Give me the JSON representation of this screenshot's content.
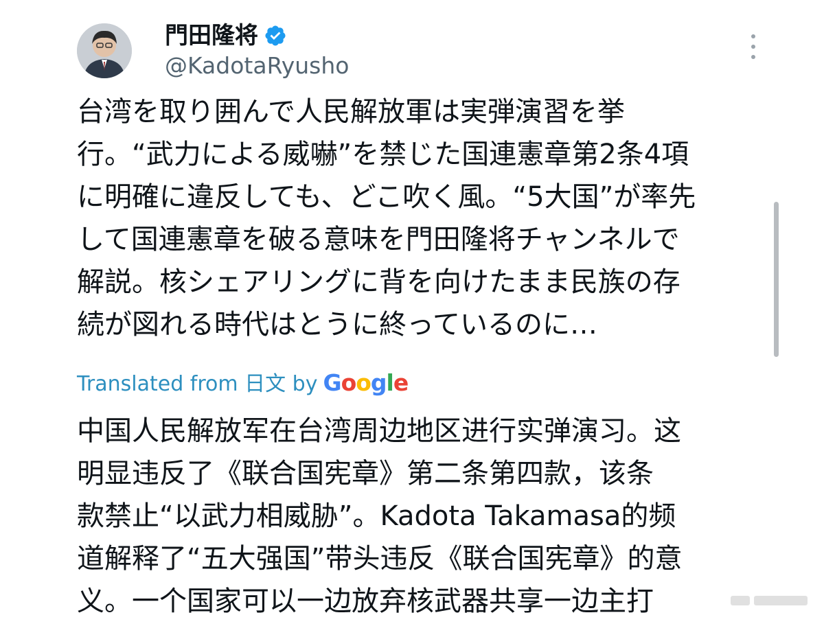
{
  "tweet": {
    "display_name": "門田隆将",
    "handle": "@KadotaRyusho",
    "original_lines": [
      "台湾を取り囲んで人民解放軍は実弾演習を挙",
      "行。“武力による威嚇”を禁じた国連憲章第2条4項",
      "に明確に違反しても、どこ吹く風。“5大国”が率先",
      "して国連憲章を破る意味を門田隆将チャンネルで",
      "解説。核シェアリングに背を向けたまま民族の存",
      "続が図れる時代はとうに終っているのに…"
    ],
    "translation": {
      "prefix": "Translated from 日文 by",
      "google": [
        "G",
        "o",
        "o",
        "g",
        "l",
        "e"
      ]
    },
    "translated_lines": [
      "中国人民解放军在台湾周边地区进行实弹演习。这",
      "明显违反了《联合国宪章》第二条第四款，该条",
      "款禁止“以武力相威胁”。Kadota Takamasa的频",
      "道解释了“五大强国”带头违反《联合国宪章》的意",
      "义。一个国家可以一边放弃核武器共享一边主打"
    ]
  },
  "icons": {
    "verified": "verified-badge-icon",
    "more": "more-options-icon"
  },
  "colors": {
    "text": "#0f1419",
    "secondary": "#536471",
    "link": "#2d8fbf",
    "verified": "#1d9bf0"
  }
}
